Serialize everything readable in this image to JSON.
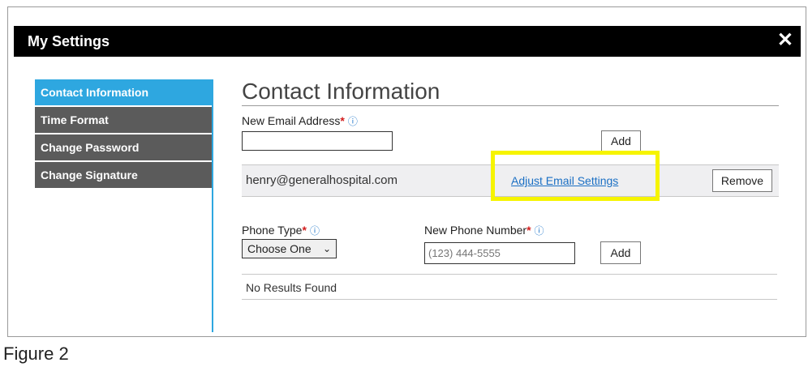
{
  "window": {
    "title": "My Settings",
    "close_glyph": "✕"
  },
  "sidebar": {
    "items": [
      {
        "label": "Contact Information",
        "active": true
      },
      {
        "label": "Time Format",
        "active": false
      },
      {
        "label": "Change Password",
        "active": false
      },
      {
        "label": "Change Signature",
        "active": false
      }
    ]
  },
  "main": {
    "title": "Contact Information",
    "email": {
      "label": "New Email Address",
      "required_mark": "*",
      "info_icon": "ⓘ",
      "value": "",
      "add_label": "Add",
      "existing": [
        {
          "address": "henry@generalhospital.com",
          "link": "Adjust Email Settings",
          "remove_label": "Remove"
        }
      ]
    },
    "phone": {
      "type_label": "Phone Type",
      "type_selected": "Choose One",
      "number_label": "New Phone Number",
      "number_placeholder": "(123) 444-5555",
      "add_label": "Add",
      "results_text": "No Results Found"
    }
  },
  "caption": "Figure 2",
  "colors": {
    "accent": "#2ea7e0",
    "highlight": "#f6f400",
    "link": "#1a6fc4",
    "required": "#d21c1c"
  }
}
